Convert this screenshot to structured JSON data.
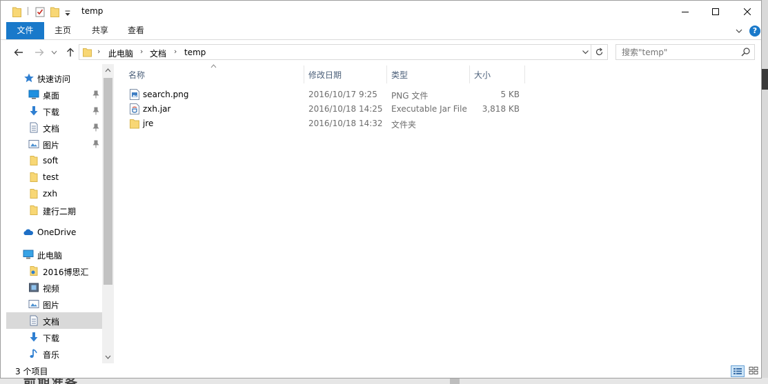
{
  "window": {
    "title": "temp",
    "folder_color": "#f8d775"
  },
  "ribbon": {
    "tabs": [
      {
        "label": "文件",
        "active": true
      },
      {
        "label": "主页"
      },
      {
        "label": "共享"
      },
      {
        "label": "查看"
      }
    ],
    "accent": "#1979ca",
    "help": "?"
  },
  "address": {
    "crumbs": [
      "此电脑",
      "文档",
      "temp"
    ],
    "search_placeholder": "搜索\"temp\""
  },
  "nav_pane": {
    "items": [
      {
        "label": "快速访问",
        "icon": "star-icon",
        "group": true
      },
      {
        "label": "桌面",
        "icon": "desktop-icon",
        "pinned": true
      },
      {
        "label": "下载",
        "icon": "download-arrow-icon",
        "pinned": true
      },
      {
        "label": "文档",
        "icon": "document-icon",
        "pinned": true
      },
      {
        "label": "图片",
        "icon": "picture-icon",
        "pinned": true
      },
      {
        "label": "soft",
        "icon": "folder-icon"
      },
      {
        "label": "test",
        "icon": "folder-icon"
      },
      {
        "label": "zxh",
        "icon": "folder-icon"
      },
      {
        "label": "建行二期",
        "icon": "folder-icon"
      },
      {
        "label": "OneDrive",
        "icon": "cloud-icon",
        "group": true
      },
      {
        "label": "此电脑",
        "icon": "computer-icon",
        "group": true
      },
      {
        "label": "2016博思汇",
        "icon": "folder-icon"
      },
      {
        "label": "视频",
        "icon": "video-icon"
      },
      {
        "label": "图片",
        "icon": "picture-icon"
      },
      {
        "label": "文档",
        "icon": "document-icon",
        "selected": true
      },
      {
        "label": "下载",
        "icon": "download-arrow-icon"
      },
      {
        "label": "音乐",
        "icon": "music-note-icon"
      }
    ]
  },
  "file_list": {
    "columns": [
      "名称",
      "修改日期",
      "类型",
      "大小"
    ],
    "rows": [
      {
        "name": "search.png",
        "modified": "2016/10/17 9:25",
        "type": "PNG 文件",
        "size": "5 KB",
        "icon": "image-file-icon"
      },
      {
        "name": "zxh.jar",
        "modified": "2016/10/18 14:25",
        "type": "Executable Jar File",
        "size": "3,818 KB",
        "icon": "jar-file-icon"
      },
      {
        "name": "jre",
        "modified": "2016/10/18 14:32",
        "type": "文件夹",
        "size": "",
        "icon": "folder-icon"
      }
    ]
  },
  "status_bar": {
    "item_count": "3 个项目"
  }
}
